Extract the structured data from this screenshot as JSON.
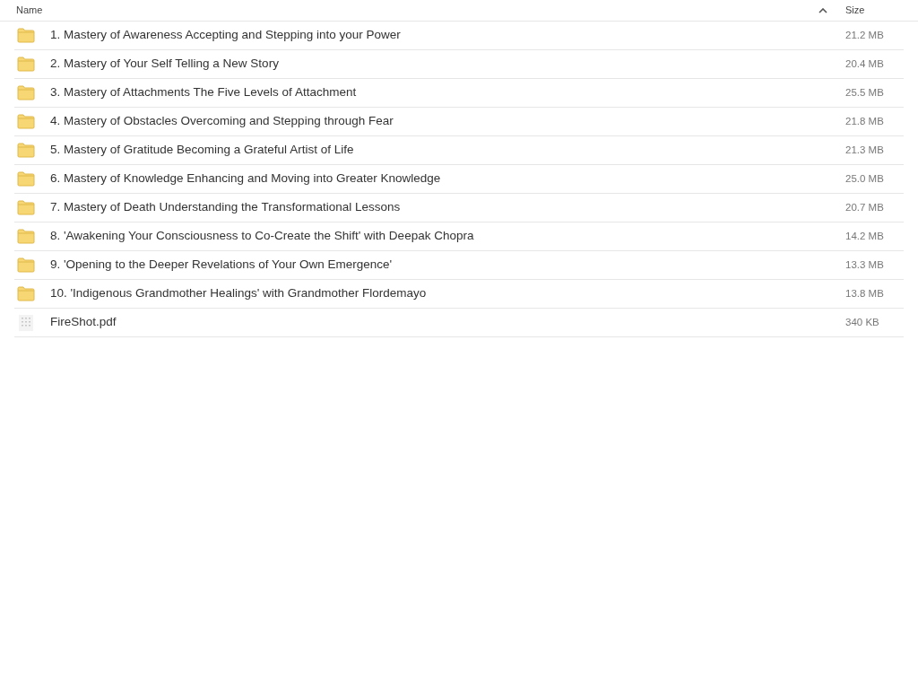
{
  "columns": [
    {
      "label": "Name",
      "sorted": true
    },
    {
      "label": "Size"
    }
  ],
  "rows": [
    {
      "kind": "folder",
      "name": "1. Mastery of Awareness Accepting and Stepping into your Power",
      "size": "21.2 MB"
    },
    {
      "kind": "folder",
      "name": "2. Mastery of Your Self Telling a New Story",
      "size": "20.4 MB"
    },
    {
      "kind": "folder",
      "name": "3. Mastery of Attachments The Five Levels of Attachment",
      "size": "25.5 MB"
    },
    {
      "kind": "folder",
      "name": "4. Mastery of Obstacles Overcoming and Stepping through Fear",
      "size": "21.8 MB"
    },
    {
      "kind": "folder",
      "name": "5. Mastery of Gratitude Becoming a Grateful Artist of Life",
      "size": "21.3 MB"
    },
    {
      "kind": "folder",
      "name": "6. Mastery of Knowledge Enhancing and Moving into Greater Knowledge",
      "size": "25.0 MB"
    },
    {
      "kind": "folder",
      "name": "7. Mastery of Death Understanding the Transformational Lessons",
      "size": "20.7 MB"
    },
    {
      "kind": "folder",
      "name": "8. 'Awakening Your Consciousness to Co-Create the Shift' with Deepak Chopra",
      "size": "14.2 MB"
    },
    {
      "kind": "folder",
      "name": "9. 'Opening to the Deeper Revelations of Your Own Emergence'",
      "size": "13.3 MB"
    },
    {
      "kind": "folder",
      "name": "10. 'Indigenous Grandmother Healings' with Grandmother Flordemayo",
      "size": "13.8 MB"
    },
    {
      "kind": "file",
      "name": "FireShot.pdf",
      "size": "340 KB"
    }
  ]
}
